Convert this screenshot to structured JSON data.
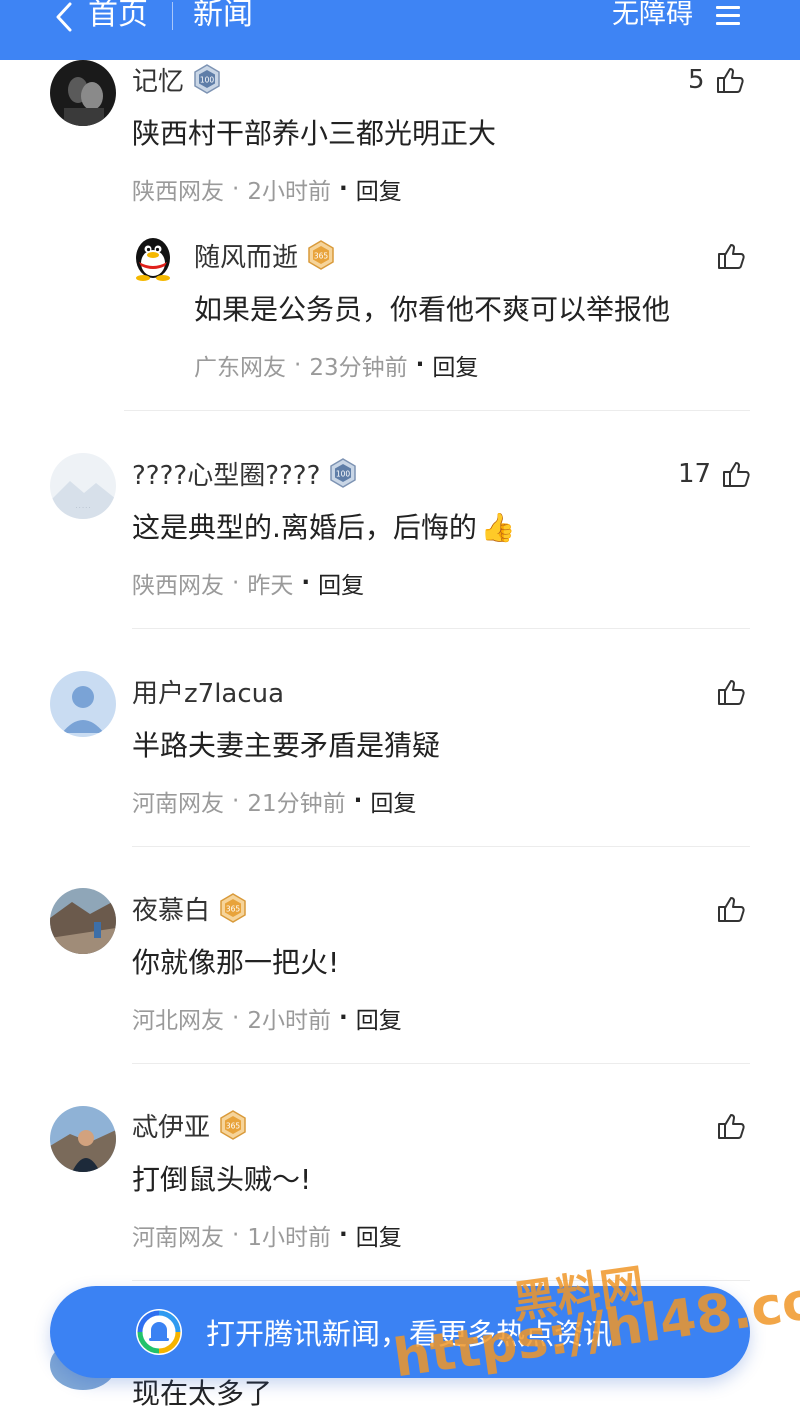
{
  "header": {
    "back_label": "首页",
    "title": "新闻",
    "accessibility_label": "无障碍"
  },
  "comments": [
    {
      "name": "记忆",
      "badge": "100",
      "likes": "5",
      "text": "陕西村干部养小三都光明正大",
      "region": "陕西网友",
      "time": "2小时前",
      "reply": "回复",
      "reply_comment": {
        "name": "随风而逝",
        "badge": "365",
        "text": "如果是公务员，你看他不爽可以举报他",
        "region": "广东网友",
        "time": "23分钟前",
        "reply": "回复"
      }
    },
    {
      "name": "????心型圈????",
      "badge": "100",
      "likes": "17",
      "text": "这是典型的.离婚后，后悔的",
      "emoji": "👍",
      "region": "陕西网友",
      "time": "昨天",
      "reply": "回复"
    },
    {
      "name": "用户z7lacua",
      "text": "半路夫妻主要矛盾是猜疑",
      "region": "河南网友",
      "time": "21分钟前",
      "reply": "回复"
    },
    {
      "name": "夜慕白",
      "badge": "365",
      "text": "你就像那一把火!",
      "region": "河北网友",
      "time": "2小时前",
      "reply": "回复"
    },
    {
      "name": "忒伊亚",
      "badge": "365",
      "text": "打倒鼠头贼～!",
      "region": "河南网友",
      "time": "1小时前",
      "reply": "回复"
    }
  ],
  "partial_comment": {
    "text": "现在太多了"
  },
  "banner": {
    "text": "打开腾讯新闻，看更多热点资讯"
  },
  "watermark": {
    "line1": "黑料网",
    "line2": "https://hl48.co"
  },
  "colors": {
    "header_bg": "#3e84f4",
    "banner_bg": "#3b82f3",
    "meta_gray": "#9a9a9a",
    "watermark_orange": "#f09628"
  }
}
